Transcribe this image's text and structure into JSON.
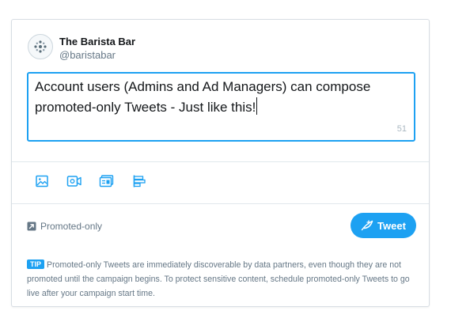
{
  "account": {
    "name": "The Barista Bar",
    "handle": "@baristabar",
    "avatar_icon": "barista-logo-icon"
  },
  "composer": {
    "text": "Account users (Admins and Ad Managers) can compose promoted-only Tweets - Just like this!",
    "char_count": "51"
  },
  "media_buttons": [
    {
      "icon": "photo-icon"
    },
    {
      "icon": "video-icon"
    },
    {
      "icon": "card-icon"
    },
    {
      "icon": "poll-icon"
    }
  ],
  "promoted": {
    "icon": "promoted-arrow-icon",
    "label": "Promoted-only"
  },
  "tweet_button": {
    "icon": "feather-icon",
    "label": "Tweet"
  },
  "tip": {
    "badge": "TIP",
    "text": "Promoted-only Tweets are immediately discoverable by data partners, even though they are not promoted until the campaign begins. To protect sensitive content, schedule promoted-only Tweets to go live after your campaign start time."
  },
  "colors": {
    "accent": "#1da1f2",
    "muted_text": "#657786",
    "border": "#d7dde3"
  }
}
